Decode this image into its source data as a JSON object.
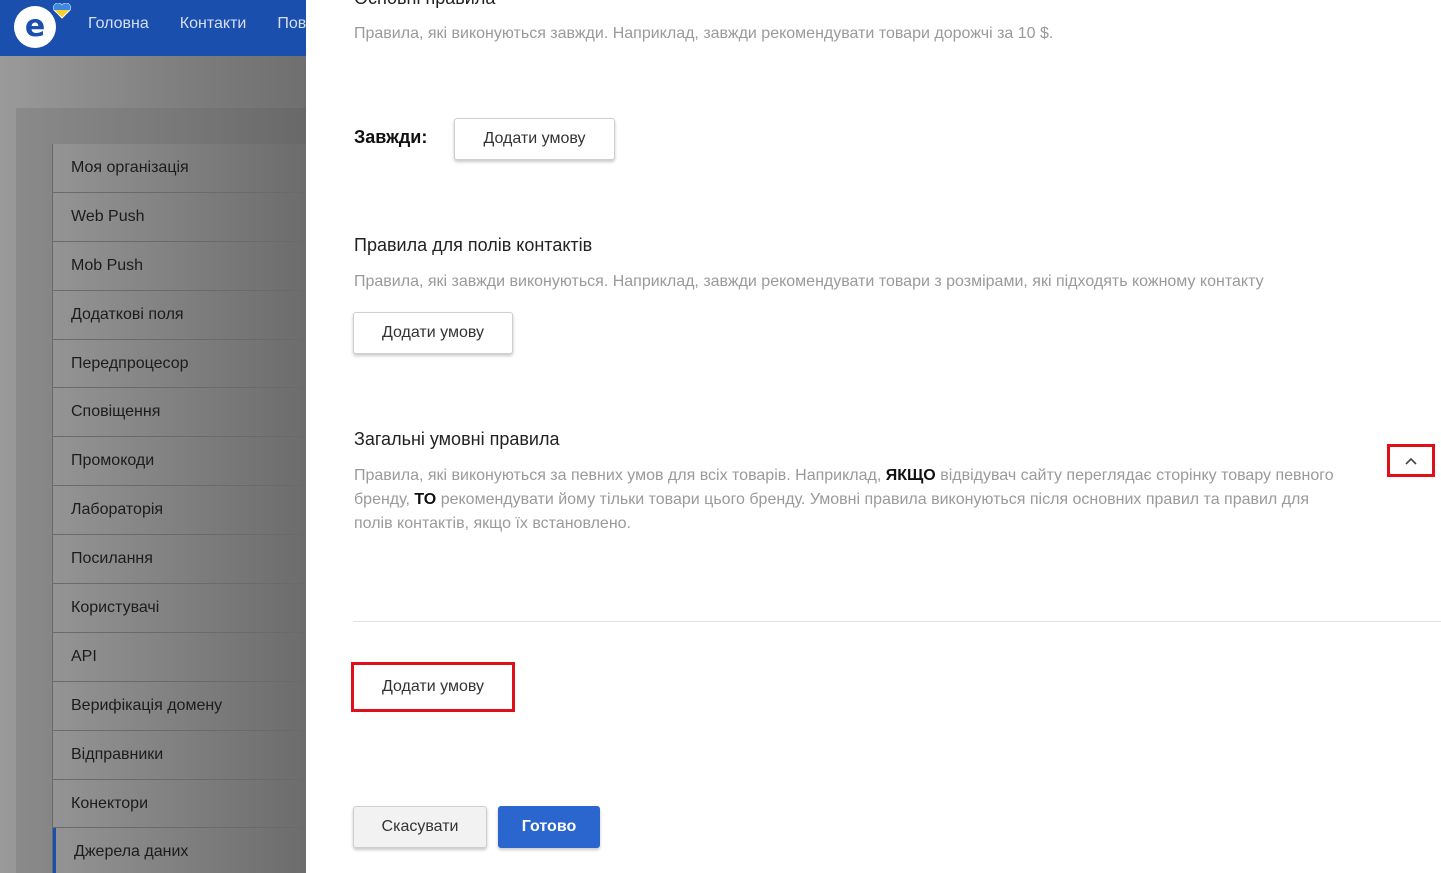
{
  "header": {
    "nav": [
      "Головна",
      "Контакти",
      "Пові"
    ]
  },
  "sidebar": {
    "items": [
      "Моя організація",
      "Web Push",
      "Mob Push",
      "Додаткові поля",
      "Передпроцесор",
      "Сповіщення",
      "Промокоди",
      "Лабораторія",
      "Посилання",
      "Користувачі",
      "API",
      "Верифікація домену",
      "Відправники",
      "Конектори",
      "Джерела даних"
    ],
    "active_index": 14
  },
  "main": {
    "basic_rules": {
      "title": "Основні правила",
      "desc": "Правила, які виконуються завжди. Наприклад, завжди рекомендувати товари дорожчі за 10 $.",
      "always_label": "Завжди:",
      "add_button": "Додати умову"
    },
    "contact_rules": {
      "title": "Правила для полів контактів",
      "desc": "Правила, які завжди виконуються. Наприклад, завжди рекомендувати товари з розмірами, які підходять кожному контакту",
      "add_button": "Додати умову"
    },
    "conditional_rules": {
      "title": "Загальні умовні правила",
      "desc_part1": "Правила, які виконуються за певних умов для всіх товарів. Наприклад, ",
      "kw_if": "ЯКЩО",
      "desc_part2": " відвідувач сайту переглядає сторінку товару певного бренду, ",
      "kw_then": "ТО",
      "desc_part3": " рекомендувати йому тільки товари цього бренду. Умовні правила виконуються після основних правил та правил для полів контактів, якщо їх встановлено.",
      "add_button": "Додати умову",
      "collapse_icon": "chevron-up-icon"
    },
    "footer": {
      "cancel": "Скасувати",
      "done": "Готово"
    }
  },
  "colors": {
    "brand": "#1a4fae",
    "primary_button": "#2b66cf",
    "highlight": "#e0101a"
  }
}
